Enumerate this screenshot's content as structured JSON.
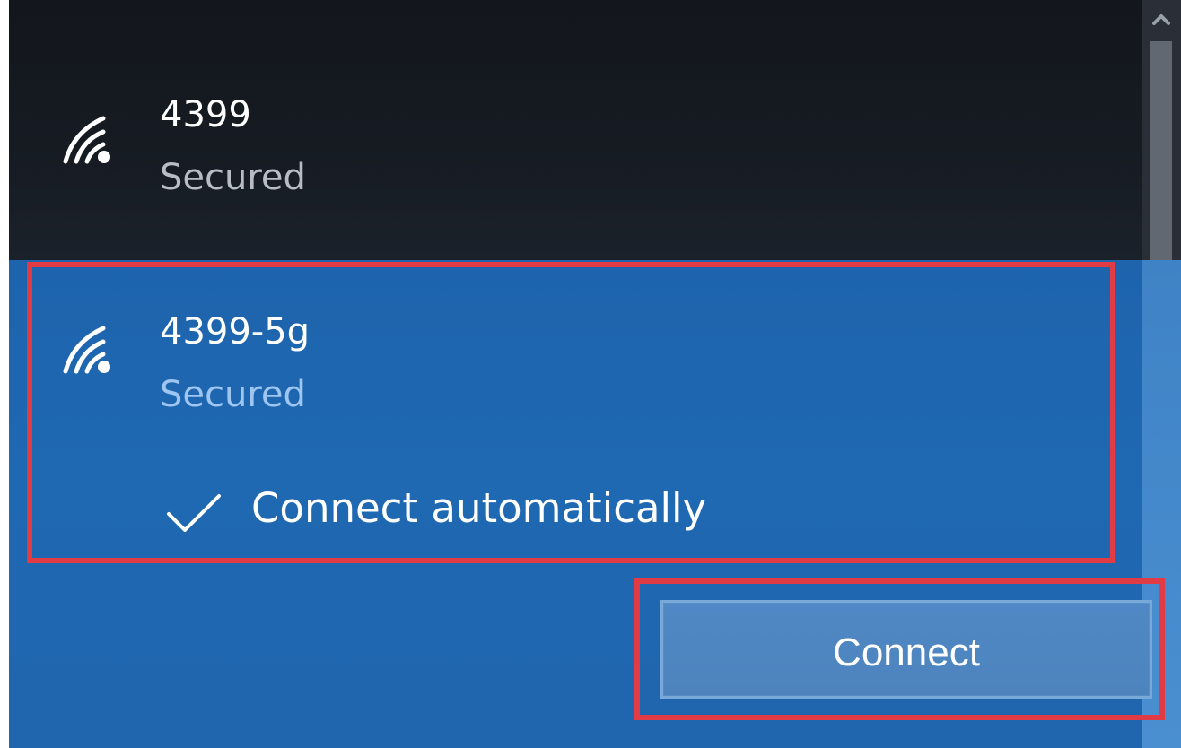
{
  "colors": {
    "top_background": "#161b22",
    "selected_background": "#1f68b2",
    "highlight_outline": "#e13b45",
    "primary_text": "#ffffff",
    "secondary_text_dark": "#b8bcc3",
    "secondary_text_blue": "#9ec6f0",
    "button_fill": "#4f88c4",
    "button_border": "#79a9d9"
  },
  "networks": [
    {
      "name": "4399",
      "status": "Secured",
      "icon": "wifi-secured-icon"
    },
    {
      "name": "4399-5g",
      "status": "Secured",
      "icon": "wifi-secured-icon"
    }
  ],
  "selected_network": {
    "connect_automatically_label": "Connect automatically",
    "connect_automatically_checked": true,
    "connect_button_label": "Connect"
  },
  "icons": {
    "scroll_up": "chevron-up-icon",
    "checkbox": "checkmark-icon"
  }
}
